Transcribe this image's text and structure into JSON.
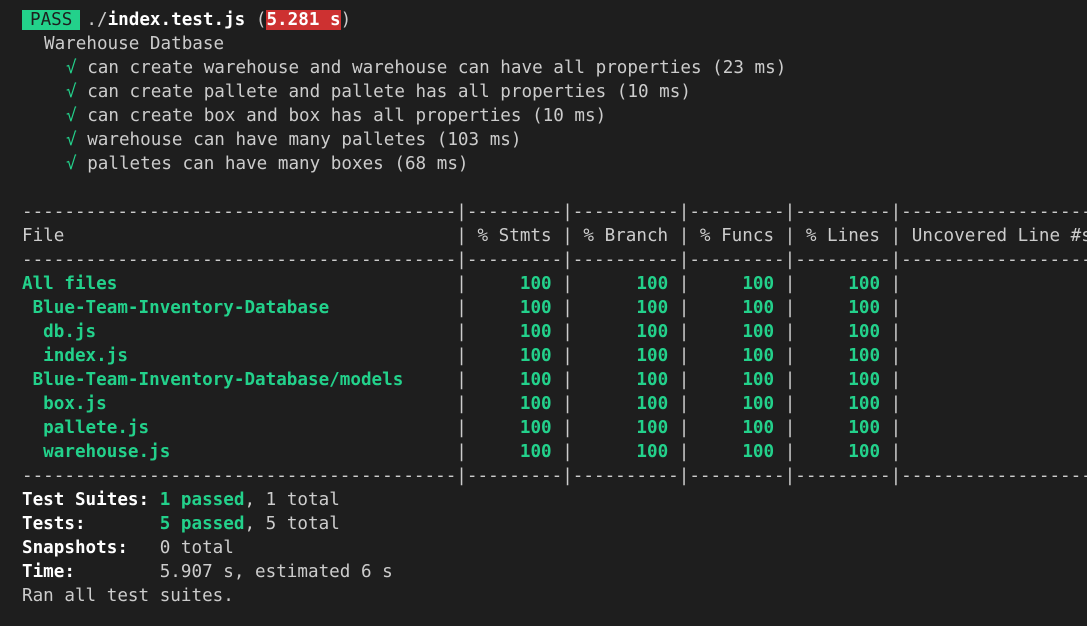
{
  "header": {
    "status": "PASS",
    "file_dir": "./",
    "file_name": "index.test.js",
    "duration_open": " (",
    "duration": "5.281 s",
    "duration_close": ")"
  },
  "suite": {
    "name": "Warehouse Datbase",
    "check_glyph": "√",
    "tests": [
      "can create warehouse and warehouse can have all properties (23 ms)",
      "can create pallete and pallete has all properties (10 ms)",
      "can create box and box has all properties (10 ms)",
      "warehouse can have many palletes (103 ms)",
      "palletes can have many boxes (68 ms)"
    ]
  },
  "coverage": {
    "separator_top": "-----------------------------------------|---------|----------|---------|---------|-------------------",
    "header": "File                                     | % Stmts | % Branch | % Funcs | % Lines | Uncovered Line #s",
    "separator_mid": "-----------------------------------------|---------|----------|---------|---------|-------------------",
    "rows": [
      {
        "file": "All files                                ",
        "stmts": "     100 ",
        "branch": "      100 ",
        "funcs": "     100 ",
        "lines": "     100 ",
        "uncovered": ""
      },
      {
        "file": " Blue-Team-Inventory-Database            ",
        "stmts": "     100 ",
        "branch": "      100 ",
        "funcs": "     100 ",
        "lines": "     100 ",
        "uncovered": ""
      },
      {
        "file": "  db.js                                  ",
        "stmts": "     100 ",
        "branch": "      100 ",
        "funcs": "     100 ",
        "lines": "     100 ",
        "uncovered": ""
      },
      {
        "file": "  index.js                               ",
        "stmts": "     100 ",
        "branch": "      100 ",
        "funcs": "     100 ",
        "lines": "     100 ",
        "uncovered": ""
      },
      {
        "file": " Blue-Team-Inventory-Database/models     ",
        "stmts": "     100 ",
        "branch": "      100 ",
        "funcs": "     100 ",
        "lines": "     100 ",
        "uncovered": ""
      },
      {
        "file": "  box.js                                 ",
        "stmts": "     100 ",
        "branch": "      100 ",
        "funcs": "     100 ",
        "lines": "     100 ",
        "uncovered": ""
      },
      {
        "file": "  pallete.js                             ",
        "stmts": "     100 ",
        "branch": "      100 ",
        "funcs": "     100 ",
        "lines": "     100 ",
        "uncovered": ""
      },
      {
        "file": "  warehouse.js                           ",
        "stmts": "     100 ",
        "branch": "      100 ",
        "funcs": "     100 ",
        "lines": "     100 ",
        "uncovered": ""
      }
    ],
    "separator_bottom": "-----------------------------------------|---------|----------|---------|---------|-------------------",
    "pipe": "|"
  },
  "summary": {
    "suites_label": "Test Suites: ",
    "suites_passed": "1 passed",
    "suites_total": ", 1 total",
    "tests_label": "Tests:       ",
    "tests_passed": "5 passed",
    "tests_total": ", 5 total",
    "snapshots_label": "Snapshots:   ",
    "snapshots_value": "0 total",
    "time_label": "Time:        ",
    "time_value": "5.907 s, estimated 6 s",
    "ran": "Ran all test suites."
  },
  "colors": {
    "background": "#1e1e1e",
    "text": "#cccccc",
    "pass_green": "#23d18b",
    "duration_red": "#cd3131"
  }
}
